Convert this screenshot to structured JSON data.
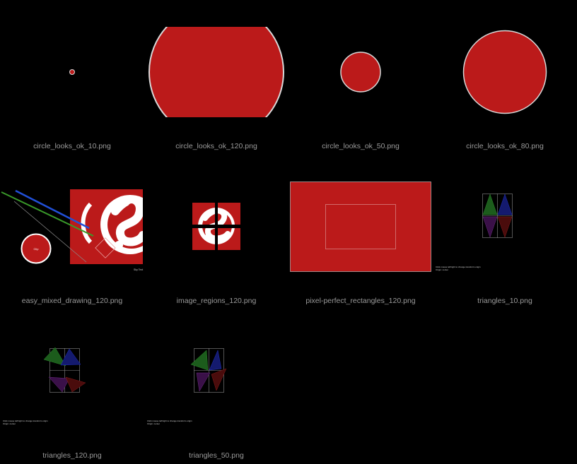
{
  "gallery": {
    "items": [
      {
        "filename": "circle_looks_ok_10.png"
      },
      {
        "filename": "circle_looks_ok_120.png"
      },
      {
        "filename": "circle_looks_ok_50.png"
      },
      {
        "filename": "circle_looks_ok_80.png"
      },
      {
        "filename": "easy_mixed_drawing_120.png"
      },
      {
        "filename": "image_regions_120.png"
      },
      {
        "filename": "pixel-perfect_rectangles_120.png"
      },
      {
        "filename": "triangles_10.png"
      },
      {
        "filename": "triangles_120.png"
      },
      {
        "filename": "triangles_50.png"
      }
    ],
    "mixed_drawing": {
      "circle_label": "Clip",
      "corner_text": "Sky Text"
    },
    "triangles": {
      "hint_line1": "Click mouse left/right to change transform origin",
      "hint_line2": "Origin: center"
    }
  },
  "colors": {
    "background": "#000000",
    "fill_red": "#BB1A1A",
    "stroke_light": "#D8D8D8",
    "caption": "#9A9A9A"
  }
}
